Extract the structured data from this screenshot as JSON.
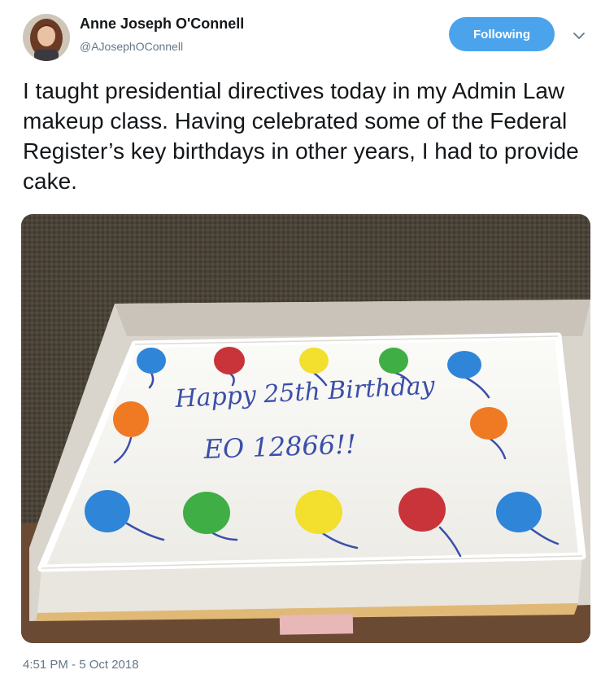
{
  "author": {
    "display_name": "Anne Joseph O'Connell",
    "handle": "@AJosephOConnell"
  },
  "follow_button": {
    "label": "Following",
    "color": "#4ba3ec"
  },
  "tweet": {
    "text": "I taught presidential directives today in my Admin Law makeup class. Having celebrated some of the Federal Register’s key birthdays in other years, I had to provide cake.",
    "timestamp": "4:51 PM - 5 Oct 2018"
  },
  "photo": {
    "cake_inscription_line1": "Happy 25th Birthday",
    "cake_inscription_line2": "EO 12866!!",
    "balloon_colors": [
      "#2f86d8",
      "#c8343a",
      "#f2df2e",
      "#3fae45",
      "#f07a24"
    ]
  },
  "colors": {
    "text": "#14171a",
    "secondary": "#657786"
  }
}
